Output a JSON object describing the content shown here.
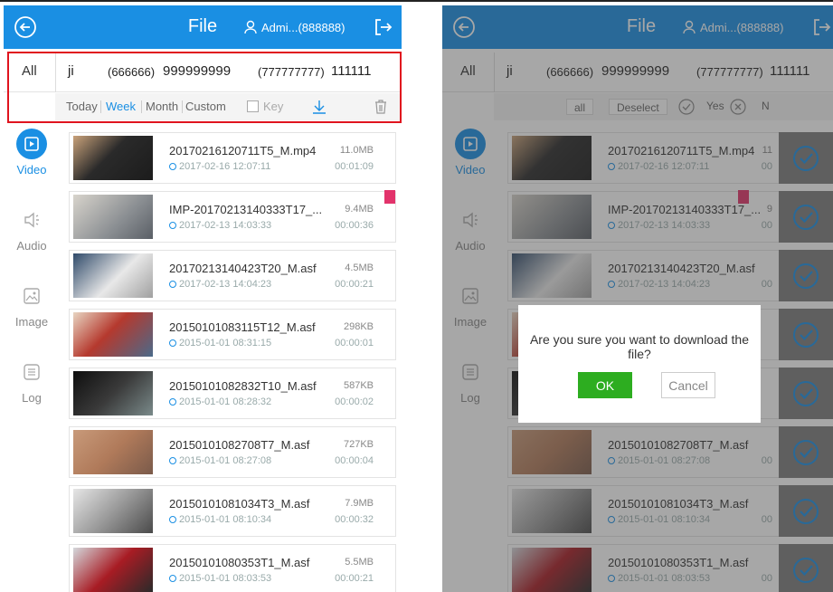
{
  "header": {
    "title": "File",
    "user": "Admi...(888888)"
  },
  "channels": {
    "all": "All",
    "items": [
      "ji",
      "(666666)",
      "999999999",
      "(777777777)",
      "111111",
      "("
    ]
  },
  "filters": {
    "items": [
      "Today",
      "Week",
      "Month",
      "Custom"
    ],
    "active": "Week",
    "key_label": "Key"
  },
  "selection_bar": {
    "all": "all",
    "deselect": "Deselect",
    "yes": "Yes",
    "no": "N"
  },
  "sidebar": {
    "items": [
      {
        "label": "Video",
        "icon": "video-icon",
        "active": true
      },
      {
        "label": "Audio",
        "icon": "audio-icon",
        "active": false
      },
      {
        "label": "Image",
        "icon": "image-icon",
        "active": false
      },
      {
        "label": "Log",
        "icon": "log-icon",
        "active": false
      }
    ]
  },
  "files": [
    {
      "name": "20170216120711T5_M.mp4",
      "date": "2017-02-16 12:07:11",
      "size": "11.0MB",
      "duration": "00:01:09",
      "locked": false
    },
    {
      "name": "IMP-20170213140333T17_...",
      "date": "2017-02-13 14:03:33",
      "size": "9.4MB",
      "duration": "00:00:36",
      "locked": true
    },
    {
      "name": "20170213140423T20_M.asf",
      "date": "2017-02-13 14:04:23",
      "size": "4.5MB",
      "duration": "00:00:21",
      "locked": false
    },
    {
      "name": "20150101083115T12_M.asf",
      "date": "2015-01-01 08:31:15",
      "size": "298KB",
      "duration": "00:00:01",
      "locked": false
    },
    {
      "name": "20150101082832T10_M.asf",
      "date": "2015-01-01 08:28:32",
      "size": "587KB",
      "duration": "00:00:02",
      "locked": false
    },
    {
      "name": "20150101082708T7_M.asf",
      "date": "2015-01-01 08:27:08",
      "size": "727KB",
      "duration": "00:00:04",
      "locked": false
    },
    {
      "name": "20150101081034T3_M.asf",
      "date": "2015-01-01 08:10:34",
      "size": "7.9MB",
      "duration": "00:00:32",
      "locked": false
    },
    {
      "name": "20150101080353T1_M.asf",
      "date": "2015-01-01 08:03:53",
      "size": "5.5MB",
      "duration": "00:00:21",
      "locked": false
    }
  ],
  "right_panel": {
    "channel_items": [
      "ji",
      "(666666)",
      "999999999",
      "(777777777)",
      "111111"
    ],
    "file_sizes": [
      "11",
      "9",
      "",
      "",
      "",
      "",
      "",
      ""
    ],
    "file_durations": [
      "00",
      "00",
      "00",
      "",
      "",
      "00",
      "00",
      "00"
    ]
  },
  "dialog": {
    "message": "Are you sure you want to download the file?",
    "ok": "OK",
    "cancel": "Cancel"
  },
  "colors": {
    "brand": "#1a8fe3",
    "highlight": "#e0141e",
    "ok": "#2dad20",
    "lock": "#e2336b"
  }
}
